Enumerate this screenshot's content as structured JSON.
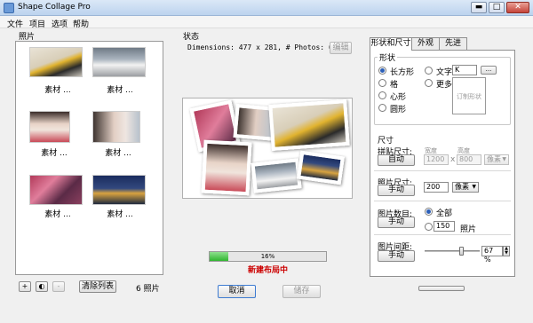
{
  "window": {
    "title": "Shape Collage Pro",
    "minimize": "▬",
    "maximize": "□",
    "close": "✕"
  },
  "menu": [
    "文件",
    "项目",
    "选项",
    "帮助"
  ],
  "photos": {
    "label": "照片",
    "items": [
      {
        "caption": "素材 ..."
      },
      {
        "caption": "素材 ..."
      },
      {
        "caption": "素材 ..."
      },
      {
        "caption": "素材 ..."
      },
      {
        "caption": "素材 ..."
      },
      {
        "caption": "素材 ..."
      }
    ],
    "add_label": "+",
    "web_label": "◐",
    "remove_label": "-",
    "clear_label": "清除列表",
    "count": "6 照片"
  },
  "status": {
    "label": "状态",
    "dimensions_text": "Dimensions: 477 x 281, # Photos: 6",
    "edit_label": "编辑",
    "progress_percent": 16,
    "progress_text": "16%",
    "progress_status": "新建布局中",
    "cancel_label": "取消",
    "save_label": "储存"
  },
  "tabs": [
    "形状和尺寸",
    "外观",
    "先进"
  ],
  "shape": {
    "label": "形状",
    "options": [
      "长方形",
      "格",
      "心形",
      "圆形"
    ],
    "selected": "长方形",
    "text_option": "文字",
    "text_value": "K",
    "text_button": "...",
    "more_option": "更多",
    "preview_text": "订制形状"
  },
  "size": {
    "label": "尺寸",
    "collage_size": {
      "label": "拼贴尺寸:",
      "button": "自动",
      "width_label": "宽度",
      "height_label": "高度",
      "width_value": "1200",
      "x_label": "x",
      "height_value": "800",
      "unit": "像素"
    },
    "photo_size": {
      "label": "照片尺寸:",
      "button": "手动",
      "value": "200",
      "unit": "像素"
    },
    "photo_count": {
      "label": "图片数目:",
      "button": "手动",
      "all_label": "全部",
      "custom_value": "150",
      "unit": "照片"
    },
    "photo_spacing": {
      "label": "图片间距:",
      "button": "手动",
      "value_percent": 67,
      "value_text": "67 %"
    }
  },
  "colors": {
    "accent": "#2b5fb8",
    "progress": "#2fb52f",
    "status_red": "#cc0000"
  }
}
